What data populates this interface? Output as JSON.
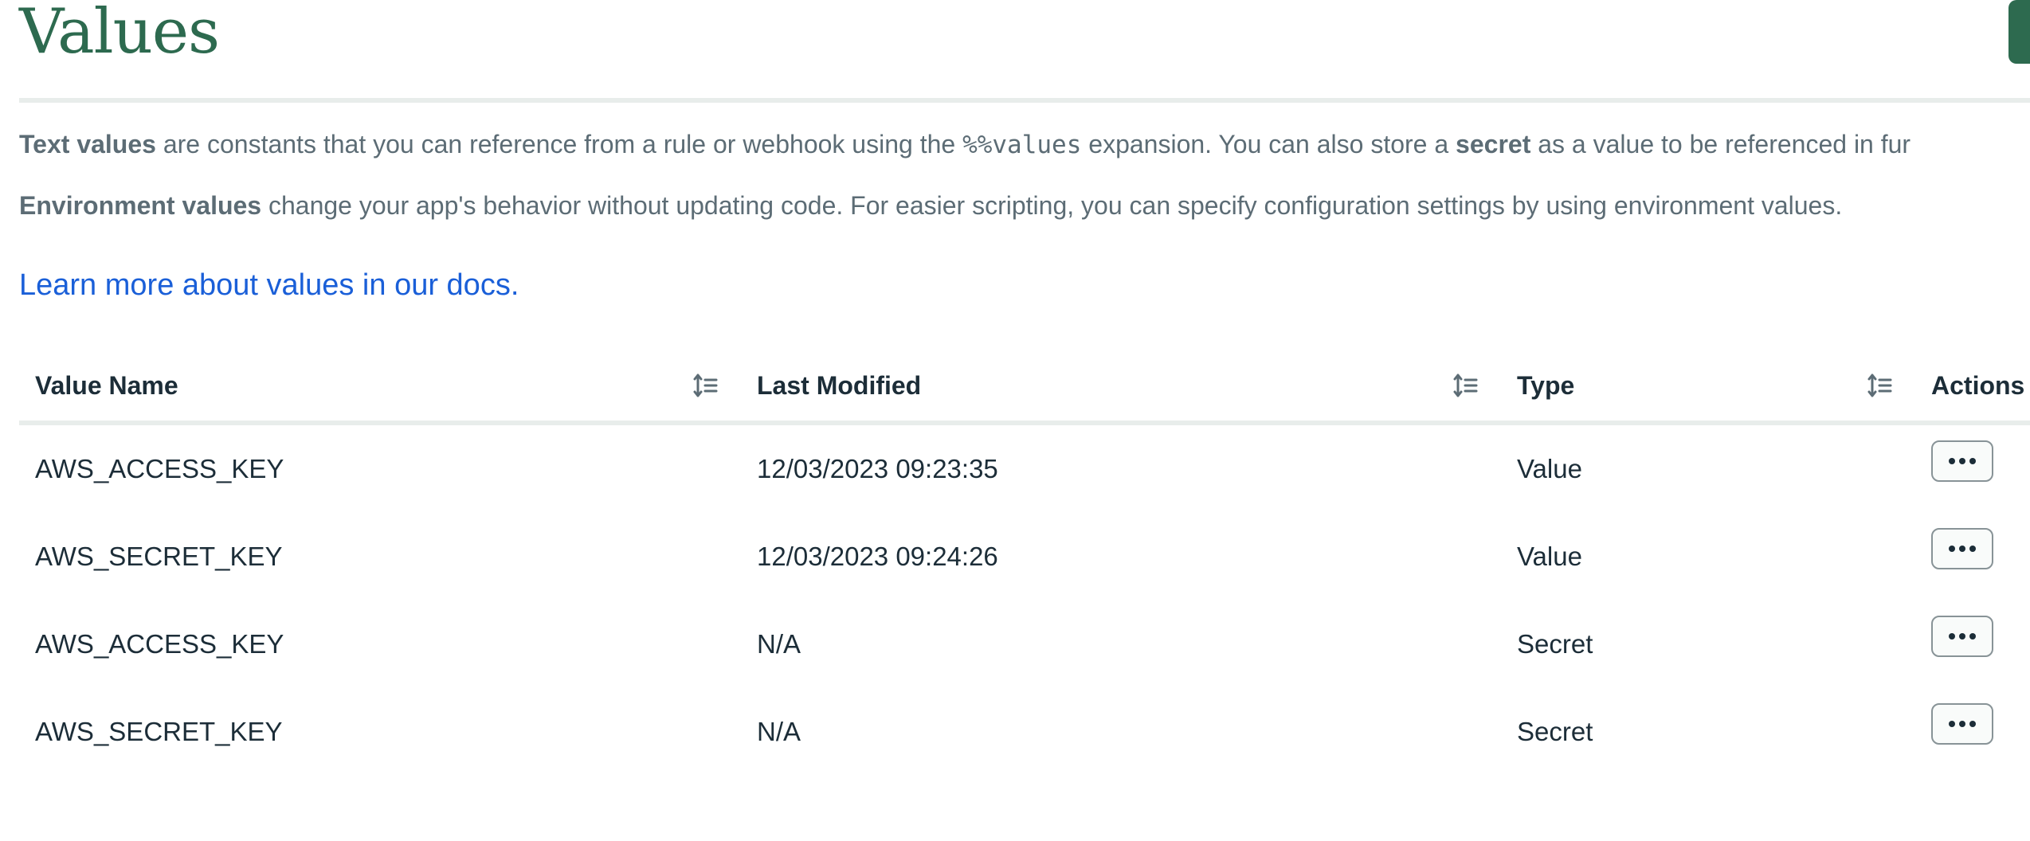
{
  "header": {
    "title": "Values"
  },
  "description": {
    "line1_bold_1": "Text values",
    "line1_text_1": " are constants that you can reference from a rule or webhook using the ",
    "line1_code": "%%values",
    "line1_text_2": " expansion. You can also store a ",
    "line1_bold_2": "secret",
    "line1_text_3": " as a value to be referenced in fur",
    "line2_bold": "Environment values",
    "line2_text": " change your app's behavior without updating code. For easier scripting, you can specify configuration settings by using environment values."
  },
  "docs_link": {
    "label": "Learn more about values in our docs."
  },
  "table": {
    "headers": {
      "name": "Value Name",
      "last_modified": "Last Modified",
      "type": "Type",
      "actions": "Actions"
    },
    "rows": [
      {
        "name": "AWS_ACCESS_KEY",
        "last_modified": "12/03/2023 09:23:35",
        "type": "Value"
      },
      {
        "name": "AWS_SECRET_KEY",
        "last_modified": "12/03/2023 09:24:26",
        "type": "Value"
      },
      {
        "name": "AWS_ACCESS_KEY",
        "last_modified": "N/A",
        "type": "Secret"
      },
      {
        "name": "AWS_SECRET_KEY",
        "last_modified": "N/A",
        "type": "Secret"
      }
    ]
  },
  "icons": {
    "sort": "sort-icon",
    "actions": "ellipsis-icon"
  },
  "colors": {
    "title": "#2d6a4f",
    "link": "#1a5fd8",
    "text": "#1c2d38",
    "muted_text": "#5c6c75",
    "divider": "#e8edeb",
    "primary_button": "#2d6a4f"
  }
}
